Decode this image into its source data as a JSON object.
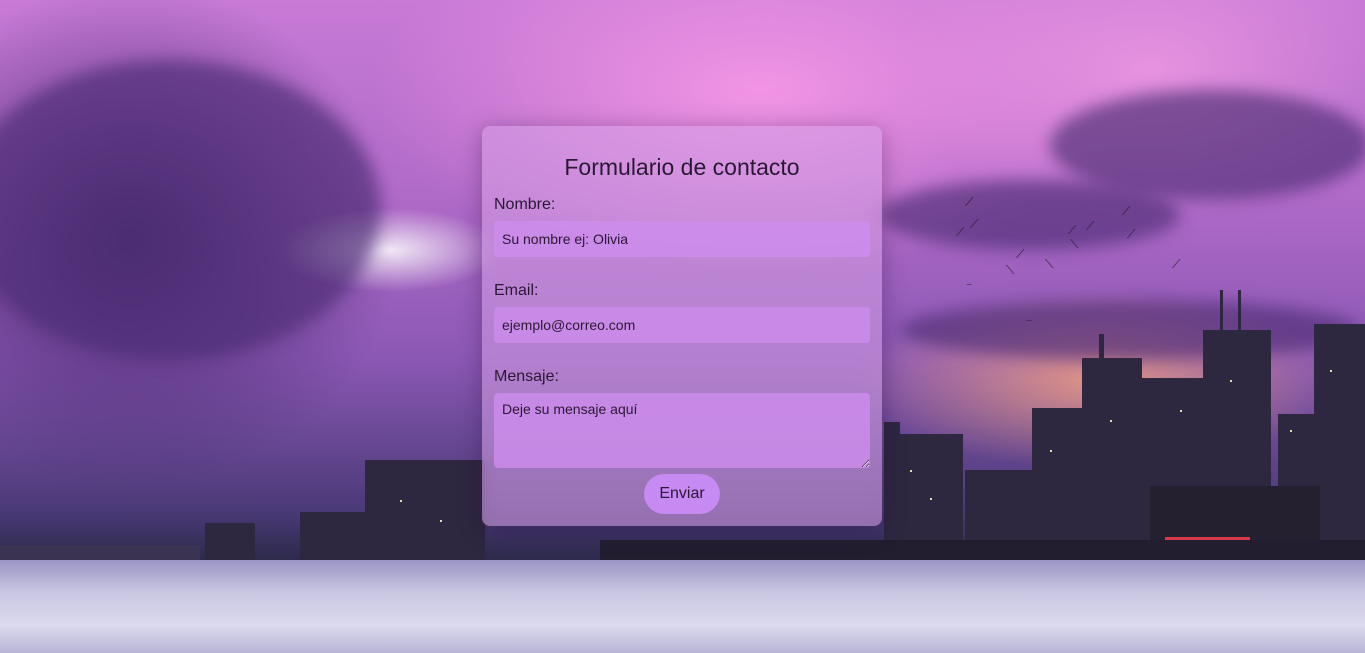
{
  "form": {
    "title": "Formulario de contacto",
    "name_label": "Nombre:",
    "name_placeholder": "Su nombre ej: Olivia",
    "email_label": "Email:",
    "email_placeholder": "ejemplo@correo.com",
    "message_label": "Mensaje:",
    "message_placeholder": "Deje su mensaje aquí",
    "submit_label": "Enviar"
  },
  "background": {
    "description_icon": "city-skyline-sunset-photo"
  },
  "colors": {
    "card": "#d6a0e6",
    "field": "#cd8ceb",
    "button": "#c68af2",
    "text": "#2b1834"
  }
}
